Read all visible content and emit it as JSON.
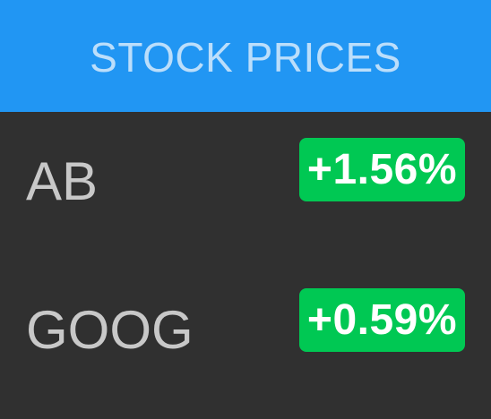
{
  "header": {
    "title": "STOCK PRICES"
  },
  "stocks": [
    {
      "symbol": "AB",
      "change": "+1.56%"
    },
    {
      "symbol": "GOOG",
      "change": "+0.59%"
    }
  ],
  "colors": {
    "header_background": "#2196F3",
    "header_text": "#BBDEFB",
    "body_background": "#303030",
    "symbol_text": "#C8C8C8",
    "positive_badge": "#00C853",
    "badge_text": "#FFFFFF"
  }
}
